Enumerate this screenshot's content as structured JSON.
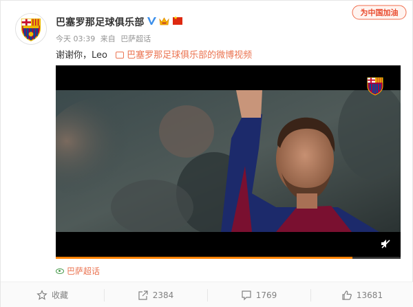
{
  "post": {
    "username": "巴塞罗那足球俱乐部",
    "meta": {
      "time": "今天 03:39",
      "source_prefix": "来自",
      "source": "巴萨超话"
    },
    "text": "谢谢你，Leo",
    "video_link": "巴塞罗那足球俱乐部的微博视频",
    "video_progress": 0.86,
    "topic": "巴萨超话",
    "corner_badge": "为中国加油"
  },
  "actions": [
    {
      "label": "收藏",
      "icon": "star-icon"
    },
    {
      "label": "2384",
      "icon": "share-icon"
    },
    {
      "label": "1769",
      "icon": "comment-icon"
    },
    {
      "label": "13681",
      "icon": "thumbs-up-icon"
    }
  ],
  "colors": {
    "accent": "#eb7350",
    "progress": "#ff8200",
    "meta_gray": "#939393"
  }
}
